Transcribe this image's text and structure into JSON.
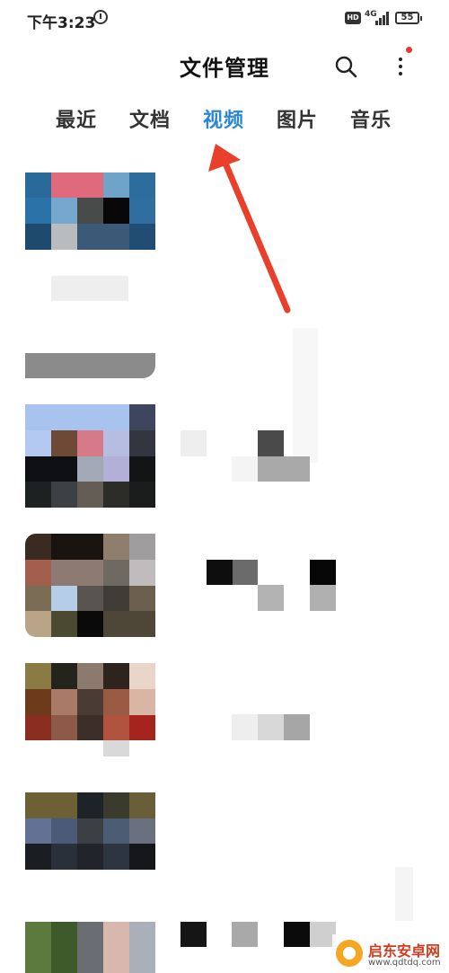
{
  "status_bar": {
    "time": "下午3:23",
    "alarm_icon": "alarm-clock-icon",
    "hd_label": "HD",
    "network": "4G",
    "battery": "55"
  },
  "header": {
    "title": "文件管理",
    "search_icon": "search-icon",
    "more_icon": "more-vertical-icon",
    "badge_color": "#e53935"
  },
  "tabs": [
    {
      "label": "最近"
    },
    {
      "label": "文档"
    },
    {
      "label": "视频",
      "active": true
    },
    {
      "label": "图片"
    },
    {
      "label": "音乐"
    }
  ],
  "colors": {
    "active_tab": "#2b86d6",
    "annotation_arrow": "#e8402a"
  },
  "watermark": {
    "name": "启东安卓网",
    "url": "www.qdtdq.com"
  }
}
